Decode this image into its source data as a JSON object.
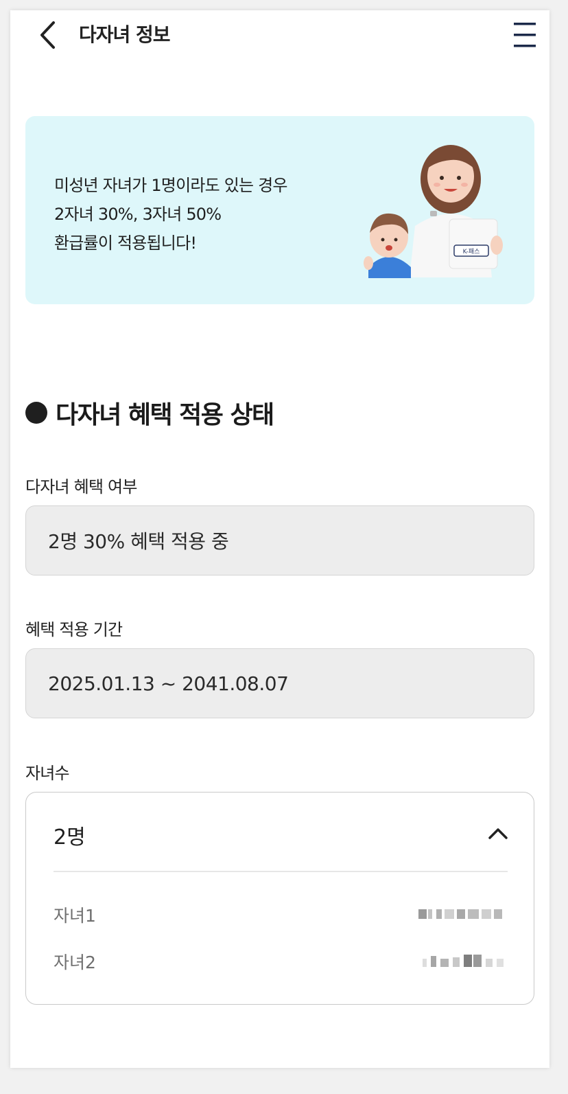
{
  "header": {
    "title": "다자녀 정보",
    "back_icon": "chevron-left-icon",
    "menu_icon": "hamburger-menu-icon"
  },
  "banner": {
    "lines": [
      "미성년 자녀가 1명이라도 있는 경우",
      "2자녀 30%, 3자녀 50%",
      "환급률이 적용됩니다!"
    ],
    "illustration_card_text": "K-패스",
    "background": "#def7fa"
  },
  "status_section": {
    "title": "다자녀 혜택 적용 상태"
  },
  "benefit": {
    "label": "다자녀 혜택 여부",
    "value": "2명 30% 혜택 적용 중"
  },
  "period": {
    "label": "혜택 적용 기간",
    "value": "2025.01.13 ~ 2041.08.07"
  },
  "children": {
    "label": "자녀수",
    "count": "2명",
    "expanded": true,
    "items": [
      {
        "label": "자녀1"
      },
      {
        "label": "자녀2"
      }
    ]
  }
}
